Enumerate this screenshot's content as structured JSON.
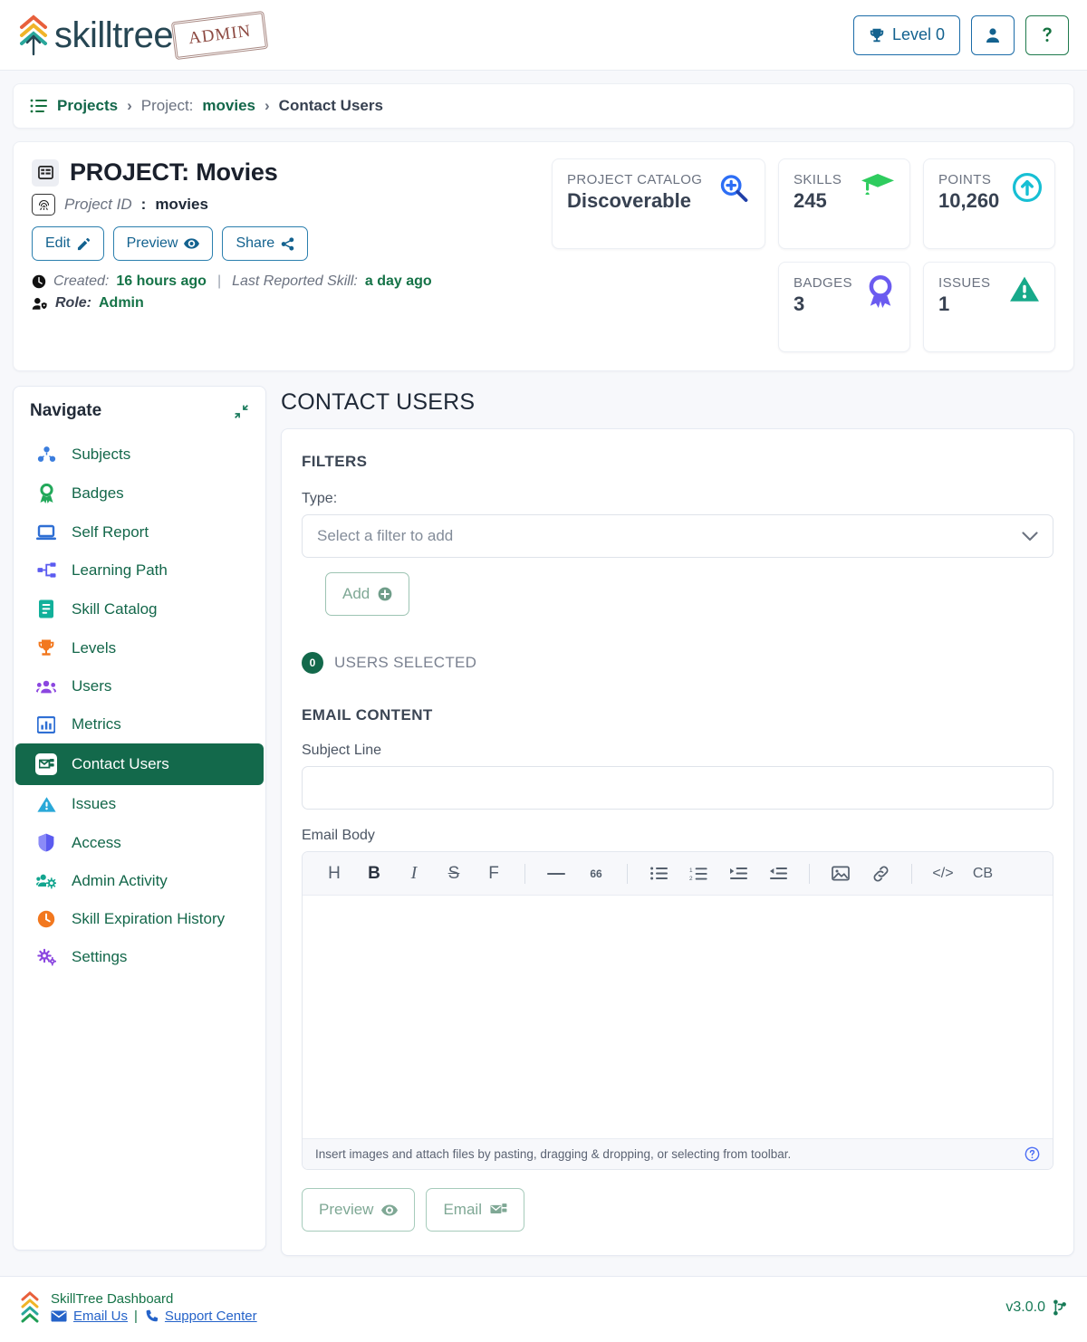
{
  "header": {
    "brand_word": "skilltree",
    "admin_stamp": "ADMIN",
    "level_button": "Level 0",
    "level_icon": "trophy-icon",
    "user_icon": "user-icon",
    "help_icon": "question-mark-icon"
  },
  "breadcrumb": {
    "icon": "list-icon",
    "projects": "Projects",
    "sep1": "›",
    "project_label": "Project:",
    "project_name": "movies",
    "sep2": "›",
    "current": "Contact Users"
  },
  "project": {
    "icon": "project-icon",
    "title": "PROJECT: Movies",
    "id_icon": "fingerprint-icon",
    "id_label": "Project ID",
    "id_sep": ":",
    "id_value": "movies",
    "buttons": [
      {
        "label": "Edit",
        "icon": "edit-pencil-icon"
      },
      {
        "label": "Preview",
        "icon": "eye-icon"
      },
      {
        "label": "Share",
        "icon": "share-icon"
      }
    ],
    "created_icon": "clock-icon",
    "created_label": "Created:",
    "created_value": "16 hours ago",
    "meta_divider": "|",
    "last_reported_label": "Last Reported Skill:",
    "last_reported_value": "a day ago",
    "role_icon": "user-shield-icon",
    "role_label": "Role:",
    "role_value": "Admin"
  },
  "stats": {
    "catalog": {
      "label": "PROJECT CATALOG",
      "value": "Discoverable",
      "icon": "magnifier-plus-icon",
      "color": "#2d6ef5"
    },
    "skills": {
      "label": "SKILLS",
      "value": "245",
      "icon": "graduation-cap-icon",
      "color": "#2ecc5e"
    },
    "points": {
      "label": "POINTS",
      "value": "10,260",
      "icon": "arrow-up-circle-icon",
      "color": "#17bfd4"
    },
    "badges": {
      "label": "BADGES",
      "value": "3",
      "icon": "award-ribbon-icon",
      "color": "#6b5bf0"
    },
    "issues": {
      "label": "ISSUES",
      "value": "1",
      "icon": "warning-triangle-icon",
      "color": "#17a98a"
    }
  },
  "sidebar": {
    "title": "Navigate",
    "collapse_icon": "compress-arrows-icon",
    "items": [
      {
        "label": "Subjects",
        "icon": "subjects-icon",
        "color": "#3b7ddd",
        "active": false
      },
      {
        "label": "Badges",
        "icon": "badge-ribbon-icon",
        "color": "#22a85a",
        "active": false
      },
      {
        "label": "Self Report",
        "icon": "laptop-icon",
        "color": "#2f6fd4",
        "active": false
      },
      {
        "label": "Learning Path",
        "icon": "sitemap-icon",
        "color": "#5b5bf0",
        "active": false
      },
      {
        "label": "Skill Catalog",
        "icon": "book-icon",
        "color": "#11b09a",
        "active": false
      },
      {
        "label": "Levels",
        "icon": "trophy-icon",
        "color": "#f2781f",
        "active": false
      },
      {
        "label": "Users",
        "icon": "users-icon",
        "color": "#8b46e0",
        "active": false
      },
      {
        "label": "Metrics",
        "icon": "bar-chart-icon",
        "color": "#2f6fd4",
        "active": false
      },
      {
        "label": "Contact Users",
        "icon": "mail-users-icon",
        "color": "#13694b",
        "active": true
      },
      {
        "label": "Issues",
        "icon": "warning-triangle-icon",
        "color": "#29a8d8",
        "active": false
      },
      {
        "label": "Access",
        "icon": "shield-icon",
        "color": "#5b5bf0",
        "active": false
      },
      {
        "label": "Admin Activity",
        "icon": "users-gear-icon",
        "color": "#12a58f",
        "active": false
      },
      {
        "label": "Skill Expiration History",
        "icon": "clock-orange-icon",
        "color": "#f2781f",
        "active": false
      },
      {
        "label": "Settings",
        "icon": "gears-icon",
        "color": "#8b46e0",
        "active": false
      }
    ]
  },
  "main": {
    "page_title": "CONTACT USERS",
    "filters_heading": "FILTERS",
    "type_label": "Type:",
    "filter_select_value": "Select a filter to add",
    "filter_caret_icon": "chevron-down-icon",
    "add_button": "Add",
    "add_button_icon": "plus-circle-icon",
    "users_selected_count": "0",
    "users_selected_label": "USERS SELECTED",
    "email_heading": "EMAIL CONTENT",
    "subject_label": "Subject Line",
    "subject_value": "",
    "subject_placeholder": "",
    "body_label": "Email Body",
    "body_value": "",
    "toolbar": [
      {
        "name": "heading-icon",
        "glyph": "H"
      },
      {
        "name": "bold-icon",
        "glyph": "B"
      },
      {
        "name": "italic-icon",
        "glyph": "I"
      },
      {
        "name": "strikethrough-icon",
        "glyph": "S"
      },
      {
        "name": "font-icon",
        "glyph": "F"
      },
      {
        "name": "separator",
        "glyph": ""
      },
      {
        "name": "horizontal-rule-icon",
        "glyph": "—"
      },
      {
        "name": "blockquote-icon",
        "glyph": "66"
      },
      {
        "name": "separator",
        "glyph": ""
      },
      {
        "name": "bullet-list-icon",
        "glyph": ""
      },
      {
        "name": "numbered-list-icon",
        "glyph": ""
      },
      {
        "name": "indent-icon",
        "glyph": ""
      },
      {
        "name": "outdent-icon",
        "glyph": ""
      },
      {
        "name": "separator",
        "glyph": ""
      },
      {
        "name": "image-icon",
        "glyph": ""
      },
      {
        "name": "link-icon",
        "glyph": ""
      },
      {
        "name": "separator",
        "glyph": ""
      },
      {
        "name": "code-icon",
        "glyph": "</>"
      },
      {
        "name": "code-block-icon",
        "glyph": "CB"
      }
    ],
    "editor_hint": "Insert images and attach files by pasting, dragging & dropping, or selecting from toolbar.",
    "editor_hint_icon": "question-circle-icon",
    "preview_button": "Preview",
    "preview_button_icon": "eye-icon",
    "email_button": "Email",
    "email_button_icon": "mail-users-icon"
  },
  "footer": {
    "logo_icon": "skilltree-chevrons-icon",
    "title": "SkillTree Dashboard",
    "email_icon": "envelope-icon",
    "email_link": "Email Us",
    "divider": "|",
    "phone_icon": "phone-icon",
    "support_link": "Support Center",
    "version": "v3.0.0",
    "version_icon": "code-branch-icon"
  }
}
